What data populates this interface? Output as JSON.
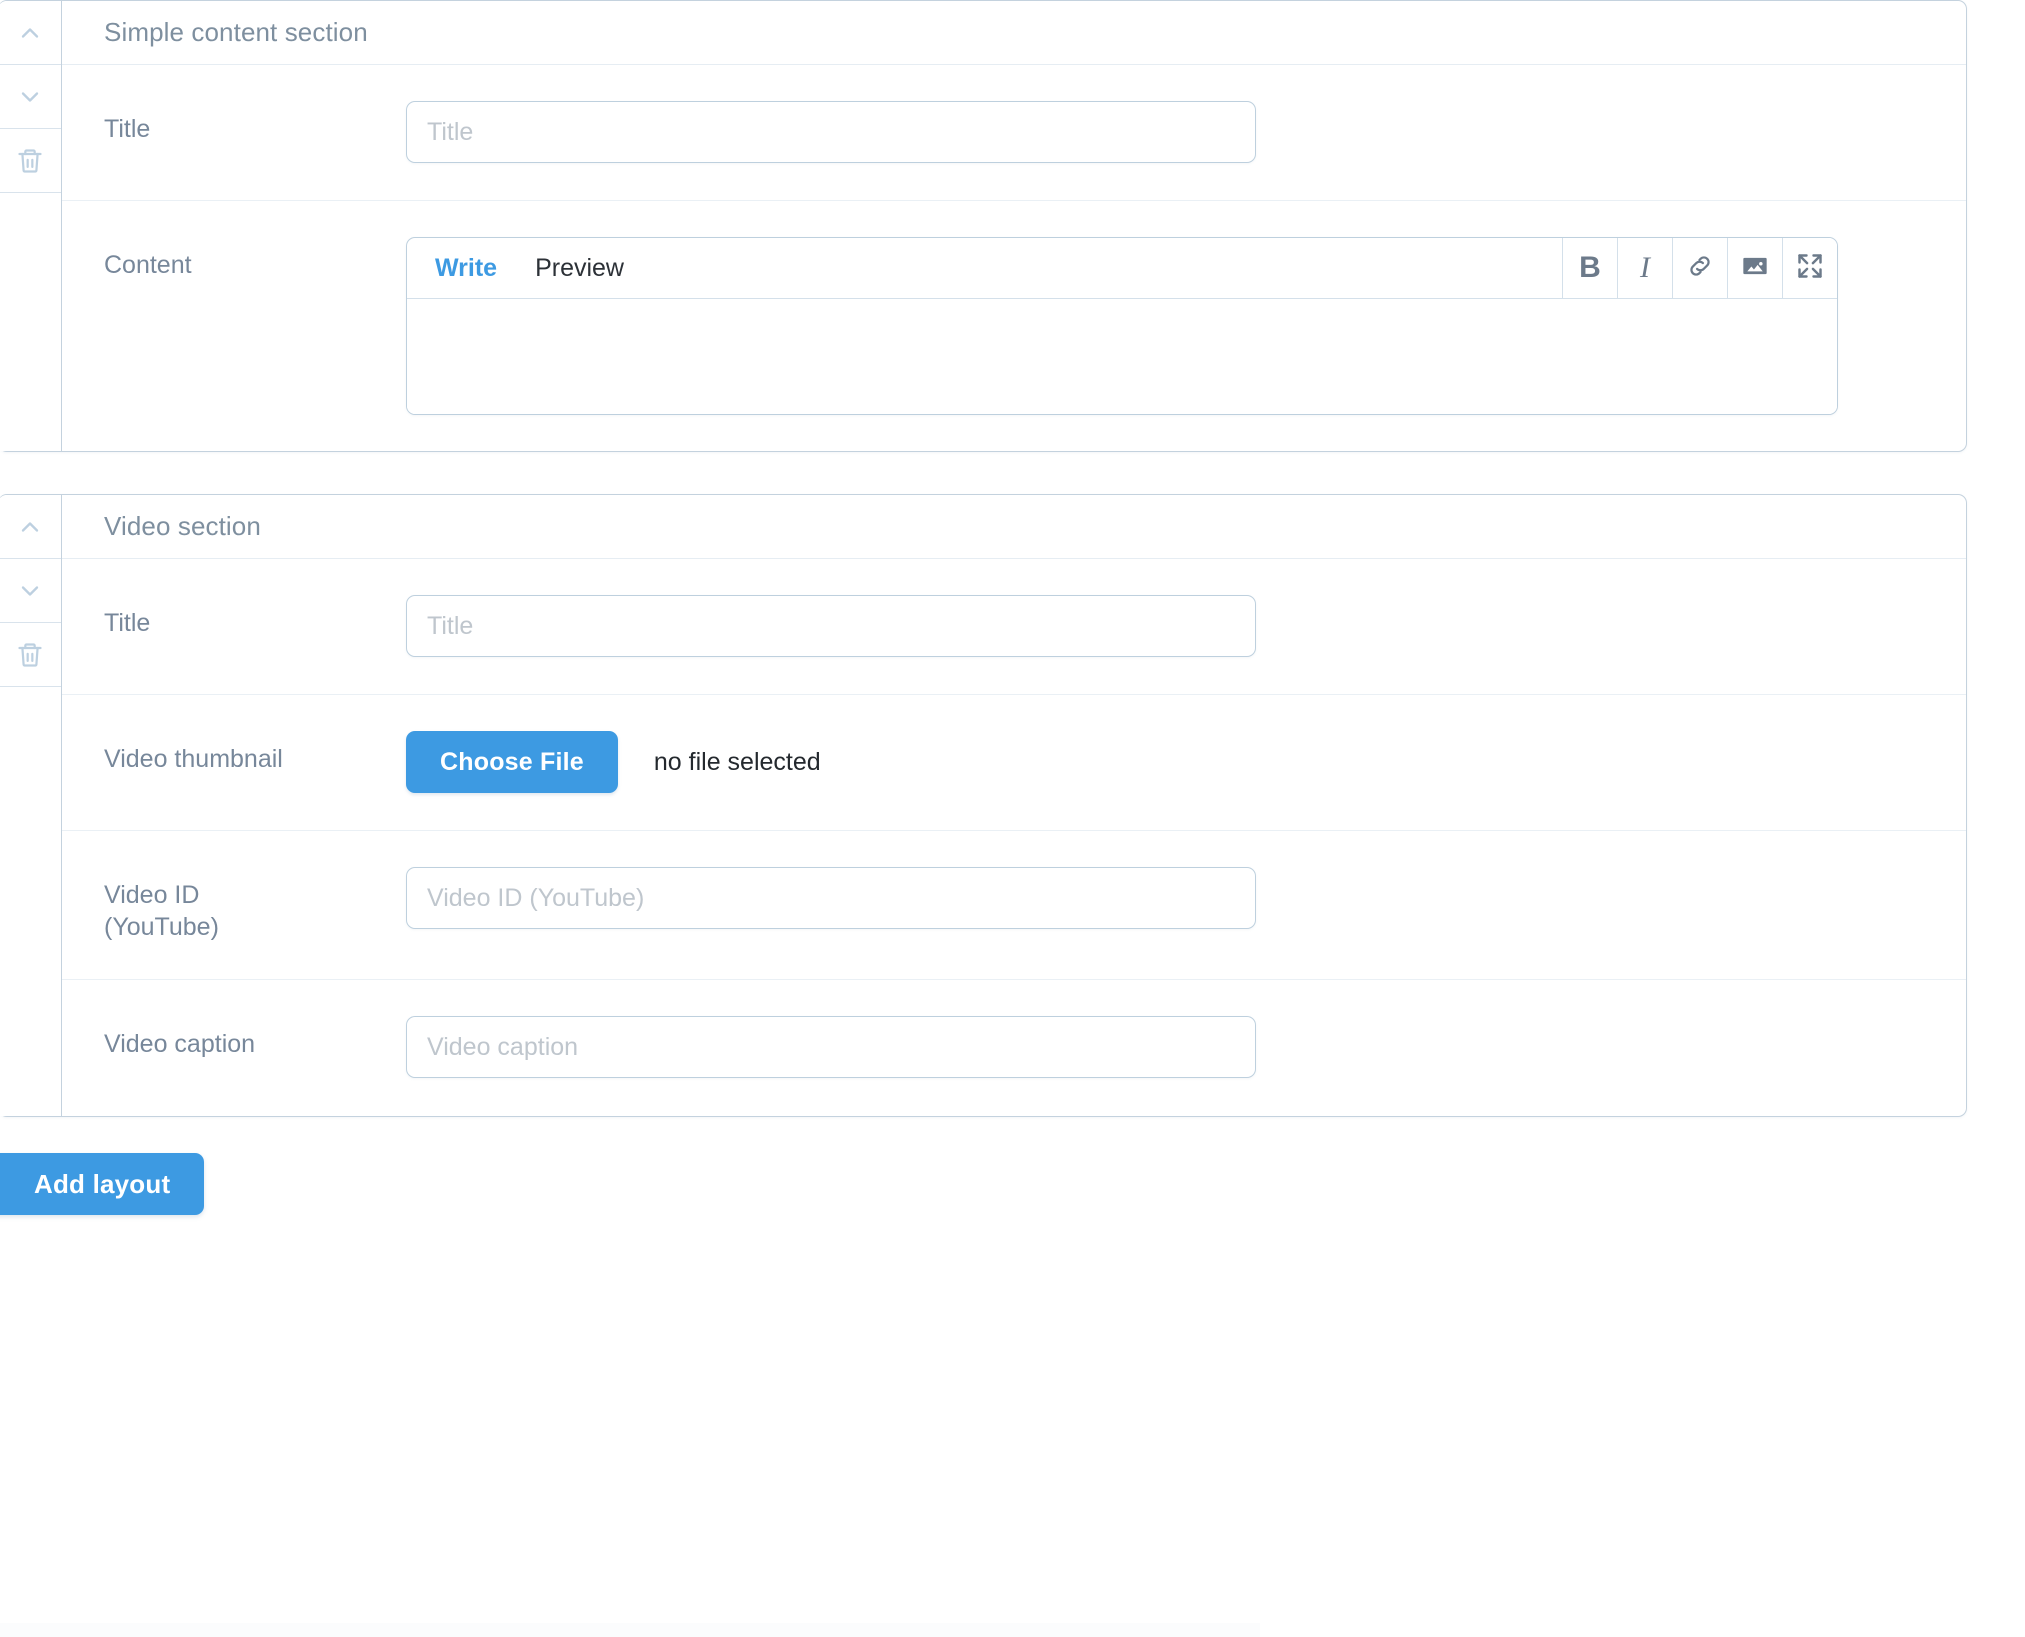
{
  "sections": [
    {
      "id": "simple-content-section",
      "title": "Simple content section",
      "controls": {
        "move_up": "move-up-icon",
        "move_down": "move-down-icon",
        "delete": "trash-icon"
      },
      "fields": [
        {
          "type": "text",
          "label": "Title",
          "placeholder": "Title",
          "value": ""
        },
        {
          "type": "markdown",
          "label": "Content",
          "tabs": [
            {
              "label": "Write",
              "active": true
            },
            {
              "label": "Preview",
              "active": false
            }
          ],
          "tools": [
            {
              "name": "bold-icon",
              "glyph": "B"
            },
            {
              "name": "italic-icon",
              "glyph": "I"
            },
            {
              "name": "link-icon",
              "glyph": ""
            },
            {
              "name": "image-icon",
              "glyph": ""
            },
            {
              "name": "fullscreen-icon",
              "glyph": ""
            }
          ],
          "value": "",
          "placeholder": ""
        }
      ]
    },
    {
      "id": "video-section",
      "title": "Video section",
      "controls": {
        "move_up": "move-up-icon",
        "move_down": "move-down-icon",
        "delete": "trash-icon"
      },
      "fields": [
        {
          "type": "text",
          "label": "Title",
          "placeholder": "Title",
          "value": ""
        },
        {
          "type": "file",
          "label": "Video thumbnail",
          "button_label": "Choose File",
          "status": "no file selected"
        },
        {
          "type": "text",
          "label": "Video ID\n(YouTube)",
          "placeholder": "Video ID (YouTube)",
          "value": ""
        },
        {
          "type": "text",
          "label": "Video caption",
          "placeholder": "Video caption",
          "value": ""
        }
      ]
    }
  ],
  "footer": {
    "add_layout_label": "Add layout"
  },
  "colors": {
    "accent": "#3d9ae2",
    "label_text": "#77879a",
    "panel_border": "#c4d2de",
    "input_border": "#bed0de",
    "placeholder": "#bfc6cd",
    "icon_muted": "#6c7a8a",
    "rail_icon": "#bdd0e0"
  }
}
